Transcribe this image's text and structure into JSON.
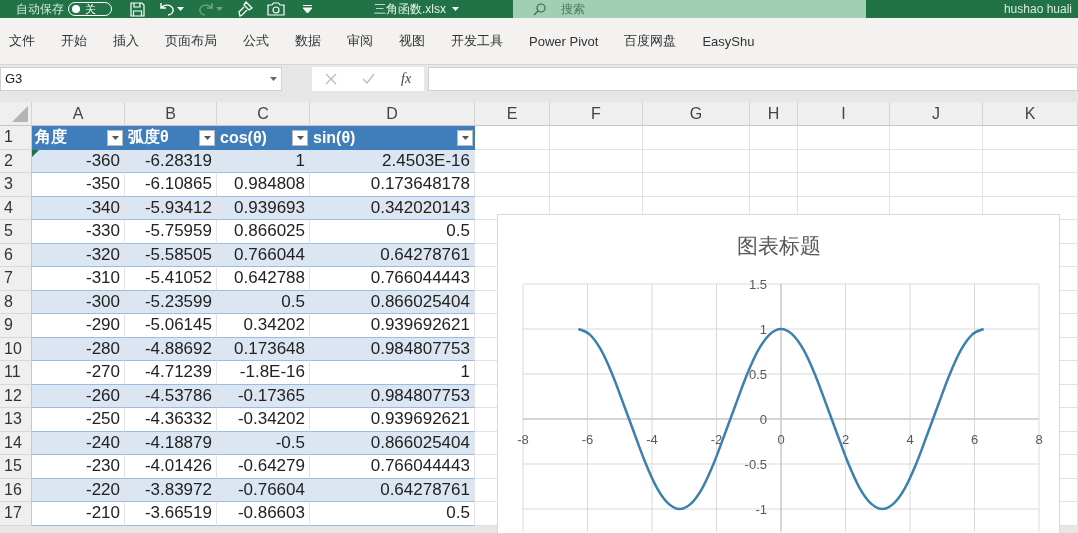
{
  "title_bar": {
    "autosave": {
      "label": "自动保存",
      "on": false,
      "state_text": "关"
    },
    "redo_disabled": true,
    "filename": "三角函数.xlsx",
    "search": {
      "placeholder": "搜索"
    },
    "user": "hushao huali"
  },
  "ribbon_tabs": [
    "文件",
    "开始",
    "插入",
    "页面布局",
    "公式",
    "数据",
    "审阅",
    "视图",
    "开发工具",
    "Power Pivot",
    "百度网盘",
    "EasyShu"
  ],
  "formula_bar": {
    "name_box": "G3",
    "fx_label": "fx"
  },
  "sheet": {
    "columns": [
      "A",
      "B",
      "C",
      "D",
      "E",
      "F",
      "G",
      "H",
      "I",
      "J",
      "K"
    ],
    "header_row": "1",
    "header": [
      "角度",
      "弧度θ",
      "cos(θ)",
      "sin(θ)"
    ],
    "rows": [
      {
        "number": "2",
        "cells": [
          "-360",
          "-6.28319",
          "1",
          "2.4503E-16"
        ],
        "error_mark": true
      },
      {
        "number": "3",
        "cells": [
          "-350",
          "-6.10865",
          "0.984808",
          "0.173648178"
        ]
      },
      {
        "number": "4",
        "cells": [
          "-340",
          "-5.93412",
          "0.939693",
          "0.342020143"
        ]
      },
      {
        "number": "5",
        "cells": [
          "-330",
          "-5.75959",
          "0.866025",
          "0.5"
        ]
      },
      {
        "number": "6",
        "cells": [
          "-320",
          "-5.58505",
          "0.766044",
          "0.64278761"
        ]
      },
      {
        "number": "7",
        "cells": [
          "-310",
          "-5.41052",
          "0.642788",
          "0.766044443"
        ]
      },
      {
        "number": "8",
        "cells": [
          "-300",
          "-5.23599",
          "0.5",
          "0.866025404"
        ]
      },
      {
        "number": "9",
        "cells": [
          "-290",
          "-5.06145",
          "0.34202",
          "0.939692621"
        ]
      },
      {
        "number": "10",
        "cells": [
          "-280",
          "-4.88692",
          "0.173648",
          "0.984807753"
        ]
      },
      {
        "number": "11",
        "cells": [
          "-270",
          "-4.71239",
          "-1.8E-16",
          "1"
        ]
      },
      {
        "number": "12",
        "cells": [
          "-260",
          "-4.53786",
          "-0.17365",
          "0.984807753"
        ]
      },
      {
        "number": "13",
        "cells": [
          "-250",
          "-4.36332",
          "-0.34202",
          "0.939692621"
        ]
      },
      {
        "number": "14",
        "cells": [
          "-240",
          "-4.18879",
          "-0.5",
          "0.866025404"
        ]
      },
      {
        "number": "15",
        "cells": [
          "-230",
          "-4.01426",
          "-0.64279",
          "0.766044443"
        ]
      },
      {
        "number": "16",
        "cells": [
          "-220",
          "-3.83972",
          "-0.76604",
          "0.64278761"
        ]
      },
      {
        "number": "17",
        "cells": [
          "-210",
          "-3.66519",
          "-0.86603",
          "0.5"
        ]
      }
    ]
  },
  "chart": {
    "chart_data": {
      "type": "line",
      "title": "图表标题",
      "x": [
        -6.2832,
        -5.9341,
        -5.5851,
        -5.236,
        -4.8869,
        -4.5379,
        -4.1888,
        -3.8397,
        -3.4907,
        -3.1416,
        -2.7925,
        -2.4435,
        -2.0944,
        -1.7453,
        -1.3963,
        -1.0472,
        -0.6981,
        -0.3491,
        0,
        0.3491,
        0.6981,
        1.0472,
        1.3963,
        1.7453,
        2.0944,
        2.4435,
        2.7925,
        3.1416,
        3.4907,
        3.8397,
        4.1888,
        4.5379,
        4.8869,
        5.236,
        5.5851,
        5.9341,
        6.2832
      ],
      "series": [
        {
          "color": "#3b80ae",
          "values": [
            1,
            0.94,
            0.77,
            0.5,
            0.17,
            -0.17,
            -0.5,
            -0.77,
            -0.94,
            -1,
            -0.94,
            -0.77,
            -0.5,
            -0.17,
            0.17,
            0.5,
            0.77,
            0.94,
            1,
            0.94,
            0.77,
            0.5,
            0.17,
            -0.17,
            -0.5,
            -0.77,
            -0.94,
            -1,
            -0.94,
            -0.77,
            -0.5,
            -0.17,
            0.17,
            0.5,
            0.77,
            0.94,
            1
          ]
        }
      ],
      "grid": true,
      "xlim": [
        -8,
        8
      ],
      "ylim": [
        -1.25,
        1.5
      ],
      "xticks": [
        -8,
        -6,
        -4,
        -2,
        0,
        2,
        4,
        6,
        8
      ],
      "yticks": [
        -1,
        -0.5,
        0,
        0.5,
        1,
        1.5
      ]
    }
  }
}
